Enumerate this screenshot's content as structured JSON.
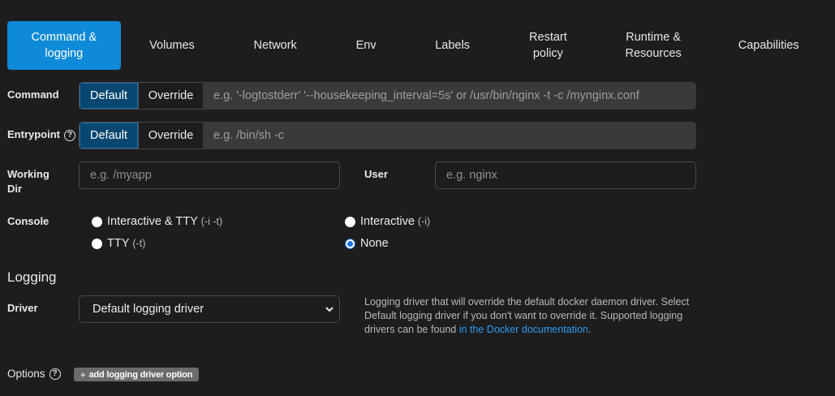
{
  "tabs": [
    {
      "label": "Command & logging",
      "active": true
    },
    {
      "label": "Volumes"
    },
    {
      "label": "Network"
    },
    {
      "label": "Env"
    },
    {
      "label": "Labels"
    },
    {
      "label": "Restart policy"
    },
    {
      "label": "Runtime & Resources"
    },
    {
      "label": "Capabilities"
    }
  ],
  "command": {
    "label": "Command",
    "default_label": "Default",
    "override_label": "Override",
    "placeholder": "e.g. '-logtostderr' '--housekeeping_interval=5s' or /usr/bin/nginx -t -c /mynginx.conf"
  },
  "entrypoint": {
    "label": "Entrypoint",
    "help_icon": "question-circle-icon",
    "default_label": "Default",
    "override_label": "Override",
    "placeholder": "e.g. /bin/sh -c"
  },
  "working_dir": {
    "label": "Working Dir",
    "placeholder": "e.g. /myapp"
  },
  "user": {
    "label": "User",
    "placeholder": "e.g. nginx"
  },
  "console": {
    "label": "Console",
    "options": [
      {
        "label": "Interactive & TTY",
        "flag": "(-i -t)",
        "checked": false
      },
      {
        "label": "Interactive",
        "flag": "(-i)",
        "checked": false
      },
      {
        "label": "TTY",
        "flag": "(-t)",
        "checked": false
      },
      {
        "label": "None",
        "flag": "",
        "checked": true
      }
    ]
  },
  "logging": {
    "title": "Logging",
    "driver_label": "Driver",
    "driver_value": "Default logging driver",
    "help_text_1": "Logging driver that will override the default docker daemon driver. Select Default logging driver if you don't want to override it. Supported logging drivers can be found ",
    "help_link": "in the Docker documentation",
    "help_text_2": ".",
    "options_label": "Options",
    "add_option_label": "add logging driver option"
  },
  "colors": {
    "background": "#1d1d1e",
    "active_tab": "#0f8ad8",
    "active_segment": "#094771",
    "link": "#2f9cf0"
  }
}
